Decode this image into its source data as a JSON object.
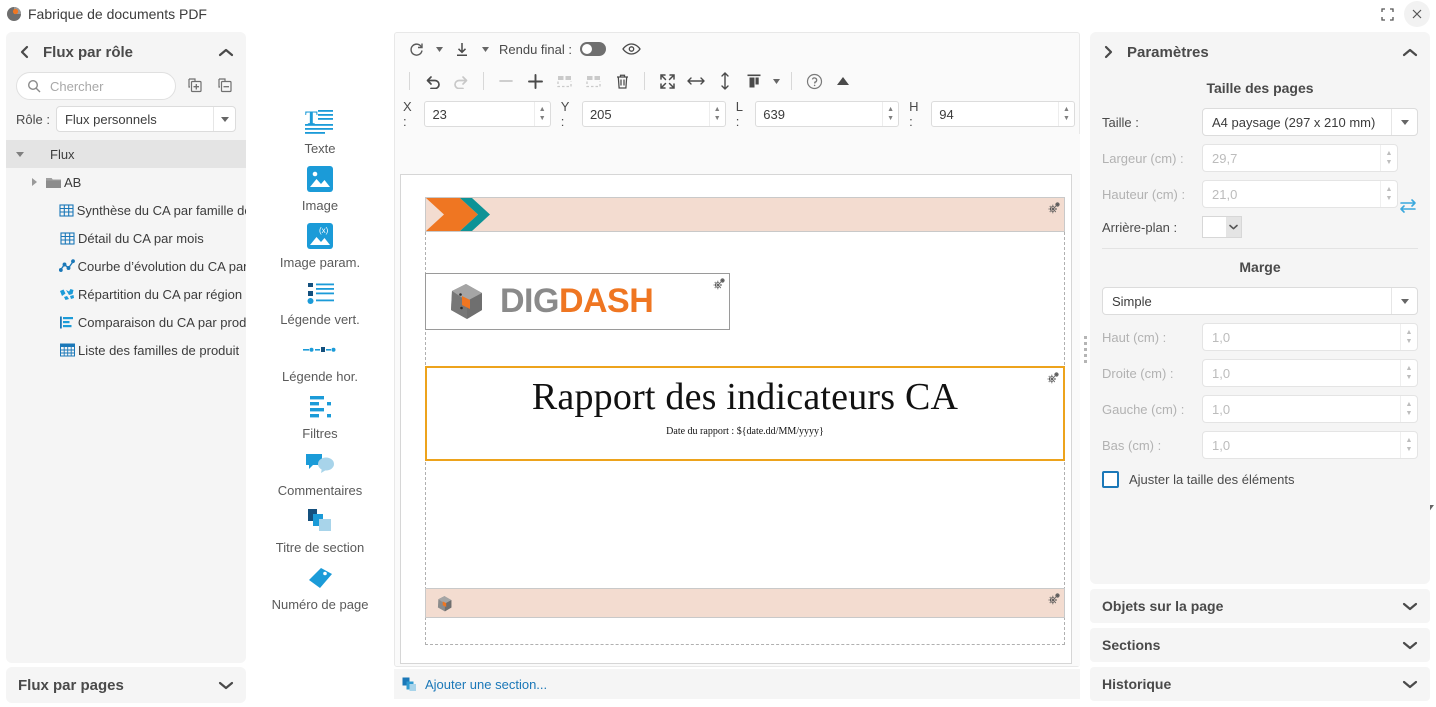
{
  "window": {
    "title": "Fabrique de documents PDF",
    "app_icon": "digdash-logo-icon",
    "maximize_label": "⛶",
    "close_label": "✕"
  },
  "left_panel": {
    "back_icon": "chevron-left-icon",
    "title": "Flux par rôle",
    "collapse_icon": "chevron-up-icon",
    "search": {
      "placeholder": "Chercher",
      "value": ""
    },
    "expand_all_icon": "expand-all-icon",
    "collapse_all_icon": "collapse-all-icon",
    "role_label": "Rôle :",
    "role_value": "Flux personnels",
    "tree": [
      {
        "label": "Flux",
        "icon": "none",
        "depth": 0,
        "twisty": "down",
        "selected": true
      },
      {
        "label": "AB",
        "icon": "folder-icon",
        "depth": 1,
        "twisty": "right",
        "selected": false
      },
      {
        "label": "Synthèse du CA par famille de",
        "icon": "table-icon",
        "depth": 2,
        "twisty": "none",
        "selected": false
      },
      {
        "label": "Détail du CA par mois",
        "icon": "table-icon",
        "depth": 2,
        "twisty": "none",
        "selected": false
      },
      {
        "label": "Courbe d’évolution du CA par",
        "icon": "line-chart-icon",
        "depth": 2,
        "twisty": "none",
        "selected": false
      },
      {
        "label": "Répartition du CA par région",
        "icon": "map-icon",
        "depth": 2,
        "twisty": "none",
        "selected": false
      },
      {
        "label": "Comparaison du CA par prod",
        "icon": "bar-chart-icon",
        "depth": 2,
        "twisty": "none",
        "selected": false
      },
      {
        "label": "Liste des familles de produit",
        "icon": "grid-icon",
        "depth": 2,
        "twisty": "none",
        "selected": false
      }
    ],
    "footer_title": "Flux par pages",
    "footer_chevron": "chevron-down-icon"
  },
  "palette": {
    "tools": [
      {
        "label": "Texte",
        "icon": "text-tool-icon"
      },
      {
        "label": "Image",
        "icon": "image-tool-icon"
      },
      {
        "label": "Image param.",
        "icon": "parametric-image-tool-icon"
      },
      {
        "label": "Légende vert.",
        "icon": "vertical-legend-tool-icon"
      },
      {
        "label": "Légende hor.",
        "icon": "horizontal-legend-tool-icon"
      },
      {
        "label": "Filtres",
        "icon": "filters-tool-icon"
      },
      {
        "label": "Commentaires",
        "icon": "comments-tool-icon"
      },
      {
        "label": "Titre de section",
        "icon": "section-title-tool-icon"
      },
      {
        "label": "Numéro de page",
        "icon": "page-number-tool-icon"
      }
    ],
    "more_icon": "triangle-down-icon"
  },
  "center": {
    "toolbar_top": {
      "refresh_icon": "refresh-icon",
      "refresh_caret": "caret-down-icon",
      "download_icon": "download-icon",
      "download_caret": "caret-down-icon",
      "render_label": "Rendu final :",
      "toggle_state": "off",
      "preview_icon": "eye-icon"
    },
    "toolbar_main": [
      {
        "name": "undo-button",
        "icon": "undo-icon",
        "enabled": true
      },
      {
        "name": "redo-button",
        "icon": "redo-icon",
        "enabled": false
      },
      {
        "name": "zoom-out-button",
        "icon": "minus-icon",
        "enabled": false
      },
      {
        "name": "zoom-in-button",
        "icon": "plus-icon",
        "enabled": true
      },
      {
        "name": "group-button",
        "icon": "group-icon",
        "enabled": false
      },
      {
        "name": "ungroup-button",
        "icon": "ungroup-icon",
        "enabled": false
      },
      {
        "name": "delete-button",
        "icon": "trash-icon",
        "enabled": true
      },
      {
        "name": "fit-button",
        "icon": "fit-page-icon",
        "enabled": true
      },
      {
        "name": "fit-width-button",
        "icon": "arrows-horizontal-icon",
        "enabled": true
      },
      {
        "name": "fit-height-button",
        "icon": "arrows-vertical-icon",
        "enabled": true
      },
      {
        "name": "align-button",
        "icon": "align-icon",
        "enabled": true
      },
      {
        "name": "help-button",
        "icon": "help-circle-icon",
        "enabled": true
      },
      {
        "name": "collapse-toolbar-button",
        "icon": "triangle-up-icon",
        "enabled": true
      }
    ],
    "coords": {
      "x_label": "X :",
      "x_value": "23",
      "y_label": "Y :",
      "y_value": "205",
      "l_label": "L :",
      "l_value": "639",
      "h_label": "H :",
      "h_value": "94"
    },
    "document": {
      "header_band": {
        "name": "header-band",
        "decoration": "orange-teal-chevron"
      },
      "logo_element": {
        "name": "digdash-logo",
        "text_dig": "DIG",
        "text_dash": "DASH"
      },
      "title_element": {
        "name": "report-title-element",
        "title": "Rapport des indicateurs CA",
        "date_text": "Date du rapport : ${date.dd/MM/yyyy}",
        "selected": true
      },
      "footer_band": {
        "name": "footer-band"
      }
    },
    "add_section_label": "Ajouter une section...",
    "add_section_icon": "add-section-icon"
  },
  "right_panel": {
    "expand_icon": "chevron-right-icon",
    "title": "Paramètres",
    "collapse_icon": "chevron-up-icon",
    "page_size_heading": "Taille des pages",
    "size_label": "Taille :",
    "size_value": "A4 paysage (297 x 210 mm)",
    "width_label": "Largeur (cm) :",
    "width_value": "29,7",
    "height_label": "Hauteur (cm) :",
    "height_value": "21,0",
    "background_label": "Arrière-plan :",
    "background_color": "#ffffff",
    "swap_icon": "swap-orientation-icon",
    "margin_heading": "Marge",
    "margin_mode": "Simple",
    "top_label": "Haut (cm) :",
    "top_value": "1,0",
    "right_label": "Droite (cm) :",
    "right_value": "1,0",
    "left_label": "Gauche (cm) :",
    "left_value": "1,0",
    "bottom_label": "Bas (cm) :",
    "bottom_value": "1,0",
    "fit_checkbox_label": "Ajuster la taille des éléments",
    "fit_checkbox_checked": false,
    "accordions": [
      {
        "label": "Objets sur la page",
        "icon": "chevron-down-icon"
      },
      {
        "label": "Sections",
        "icon": "chevron-down-icon"
      },
      {
        "label": "Historique",
        "icon": "chevron-down-icon"
      }
    ]
  },
  "colors": {
    "accent_blue": "#1b9bd8",
    "selection_orange": "#eda31c",
    "band_peach": "#f3dcd0",
    "brand_orange": "#ef7622",
    "brand_teal": "#0d9396",
    "link_blue": "#1b78b8"
  }
}
